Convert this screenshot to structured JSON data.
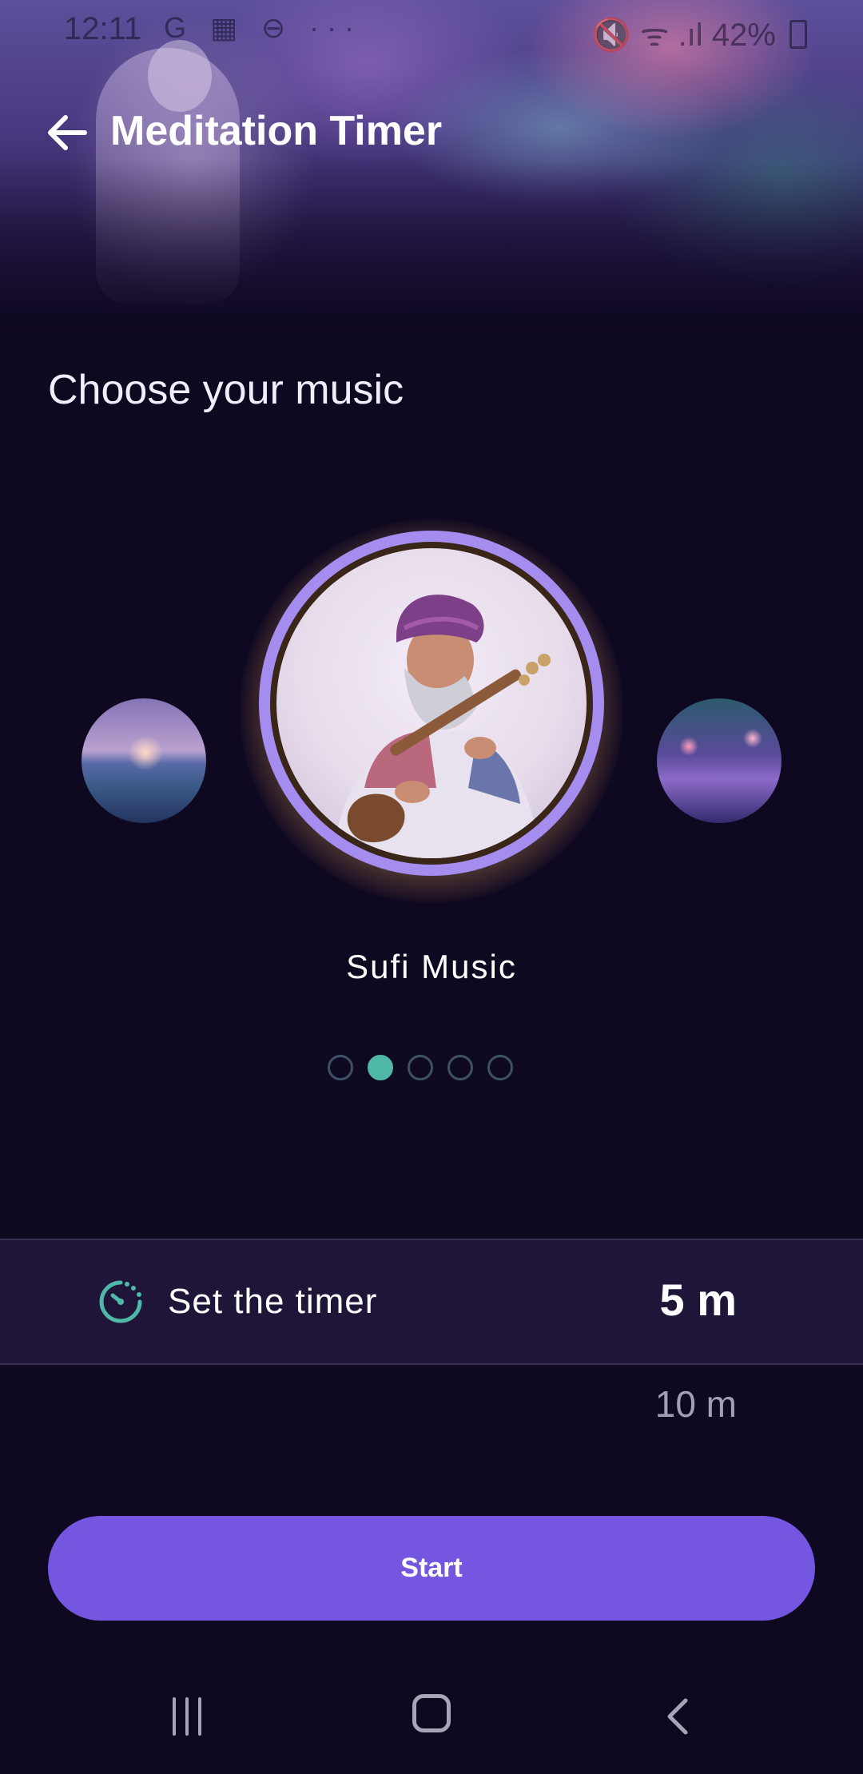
{
  "status_bar": {
    "time": "12:11",
    "left_icons": "G ▦ ⊖ ···",
    "right_icons": "🔇 ᯤ .ıl",
    "battery": "42%"
  },
  "header": {
    "title": "Meditation Timer",
    "back_icon": "arrow-left-icon"
  },
  "music": {
    "section_title": "Choose your music",
    "selected_track": "Sufi Music",
    "pager": {
      "count": 5,
      "active_index": 1
    }
  },
  "timer": {
    "label": "Set the timer",
    "icon": "timer-icon",
    "selected": "5 m",
    "next_option": "10 m"
  },
  "actions": {
    "start_label": "Start"
  },
  "colors": {
    "background": "#0f0821",
    "accent": "#7456e0",
    "active_dot": "#4fb8a8",
    "ring": "#a58df0"
  }
}
